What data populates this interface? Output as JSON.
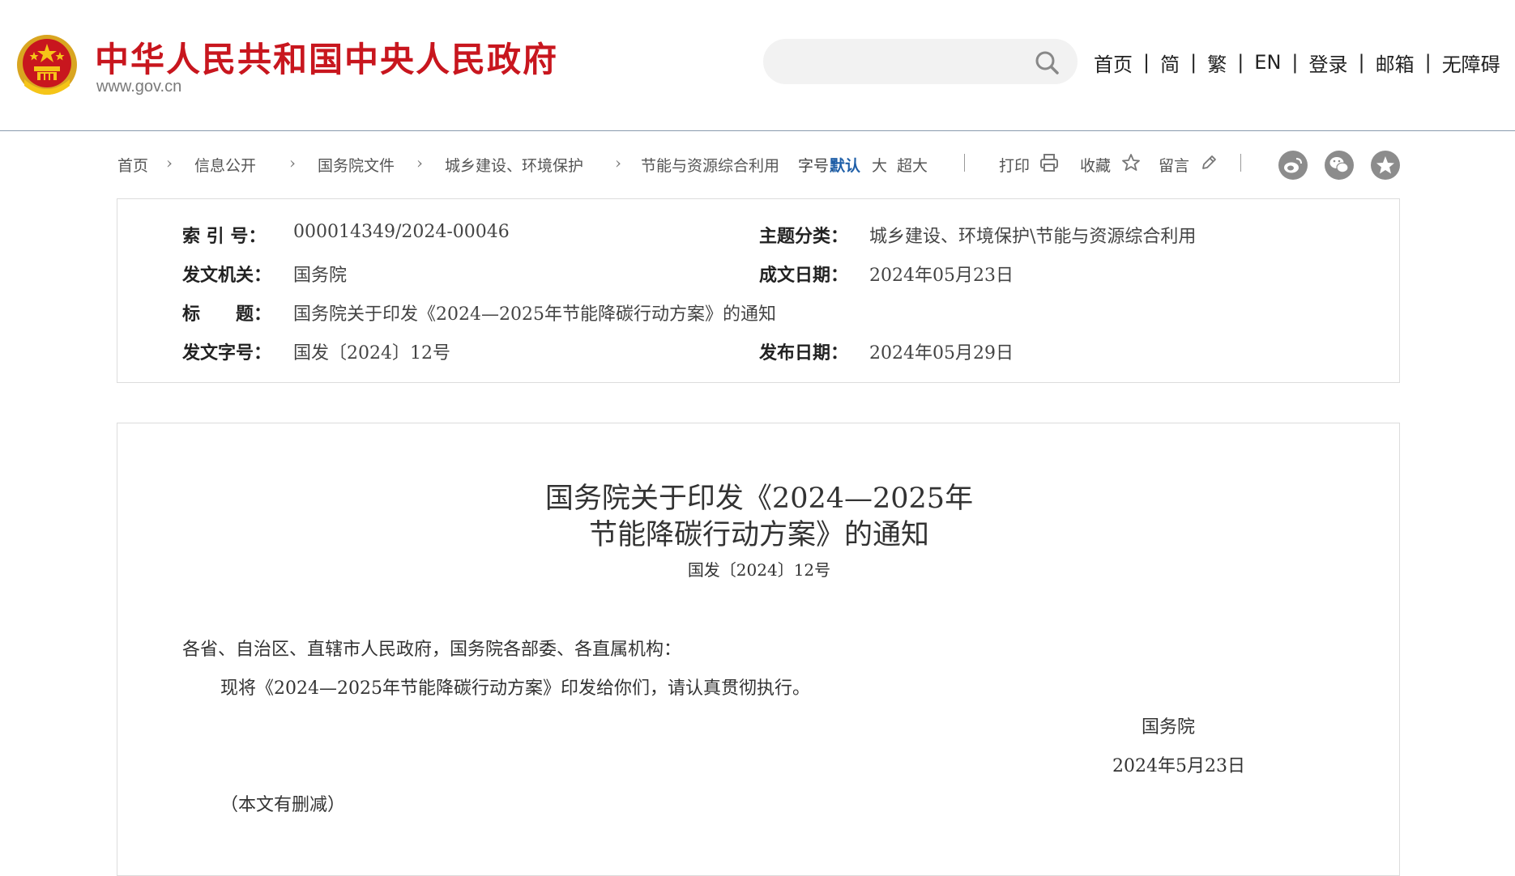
{
  "header": {
    "site_title": "中华人民共和国中央人民政府",
    "site_domain": "www.gov.cn",
    "search_placeholder": "",
    "nav": [
      "首页",
      "简",
      "繁",
      "EN",
      "登录",
      "邮箱",
      "无障碍"
    ]
  },
  "breadcrumb": [
    "首页",
    "信息公开",
    "国务院文件",
    "城乡建设、环境保护",
    "节能与资源综合利用"
  ],
  "toolbar": {
    "font_label": "字号：",
    "font_default": "默认",
    "font_large": "大",
    "font_xlarge": "超大",
    "print": "打印",
    "favorite": "收藏",
    "comment": "留言"
  },
  "share_icons": [
    "weibo-icon",
    "wechat-icon",
    "favorite-star-icon"
  ],
  "info": {
    "index_label": "索 引 号：",
    "index_value": "000014349/2024-00046",
    "topic_label": "主题分类：",
    "topic_value": "城乡建设、环境保护\\节能与资源综合利用",
    "issuer_label": "发文机关：",
    "issuer_value": "国务院",
    "written_label": "成文日期：",
    "written_value": "2024年05月23日",
    "title_label": "标　　题：",
    "title_value": "国务院关于印发《2024—2025年节能降碳行动方案》的通知",
    "docno_label": "发文字号：",
    "docno_value": "国发〔2024〕12号",
    "published_label": "发布日期：",
    "published_value": "2024年05月29日"
  },
  "document": {
    "title_line1": "国务院关于印发《2024—2025年",
    "title_line2": "节能降碳行动方案》的通知",
    "number": "国发〔2024〕12号",
    "salutation": "各省、自治区、直辖市人民政府，国务院各部委、各直属机构：",
    "body": "现将《2024—2025年节能降碳行动方案》印发给你们，请认真贯彻执行。",
    "signature": "国务院",
    "date": "2024年5月23日",
    "note": "（本文有删减）"
  },
  "colors": {
    "brand_red": "#c8161e",
    "link_blue": "#1f5fa8",
    "border_gray": "#dcdcdc",
    "icon_gray": "#8c8c8c"
  }
}
